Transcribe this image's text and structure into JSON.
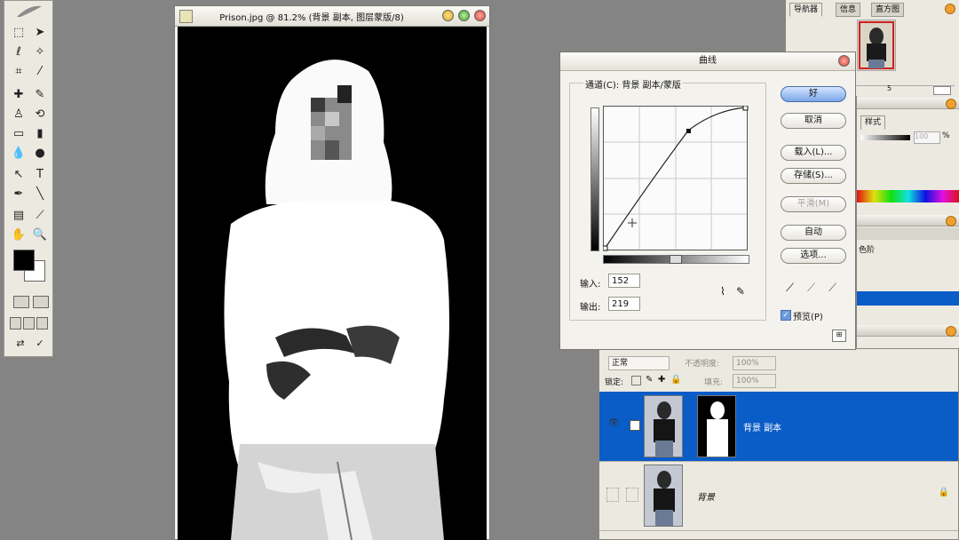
{
  "document": {
    "title": "Prison.jpg @ 81.2% (背景 副本, 图层蒙版/8)"
  },
  "curves": {
    "title": "曲线",
    "channel_label": "通道(C): 背景 副本/蒙版",
    "buttons": {
      "ok": "好",
      "cancel": "取消",
      "load": "载入(L)...",
      "save": "存储(S)...",
      "smooth": "平滑(M)",
      "auto": "自动",
      "options": "选项..."
    },
    "input_label": "输入:",
    "input_value": "152",
    "output_label": "输出:",
    "output_value": "219",
    "preview_label": "预览(P)",
    "preview_checked": true
  },
  "navigator": {
    "tabs": [
      "导航器",
      "信息",
      "直方图"
    ],
    "zoom_value": "5"
  },
  "panels": {
    "style_tab": "样式",
    "opacity_value": "100",
    "opacity_unit": "%",
    "item_label": "色阶"
  },
  "layers": {
    "blend_mode": "正常",
    "opacity_label": "不透明度:",
    "opacity_value": "100%",
    "lock_label": "锁定:",
    "fill_label": "填充:",
    "fill_value": "100%",
    "rows": [
      {
        "name": "背景 副本",
        "selected": true
      },
      {
        "name": "背景",
        "selected": false
      }
    ]
  },
  "colors": {
    "selection_blue": "#0a5cc7",
    "ok_button": "#7aa6e8",
    "panel_orange": "#f0a030"
  }
}
